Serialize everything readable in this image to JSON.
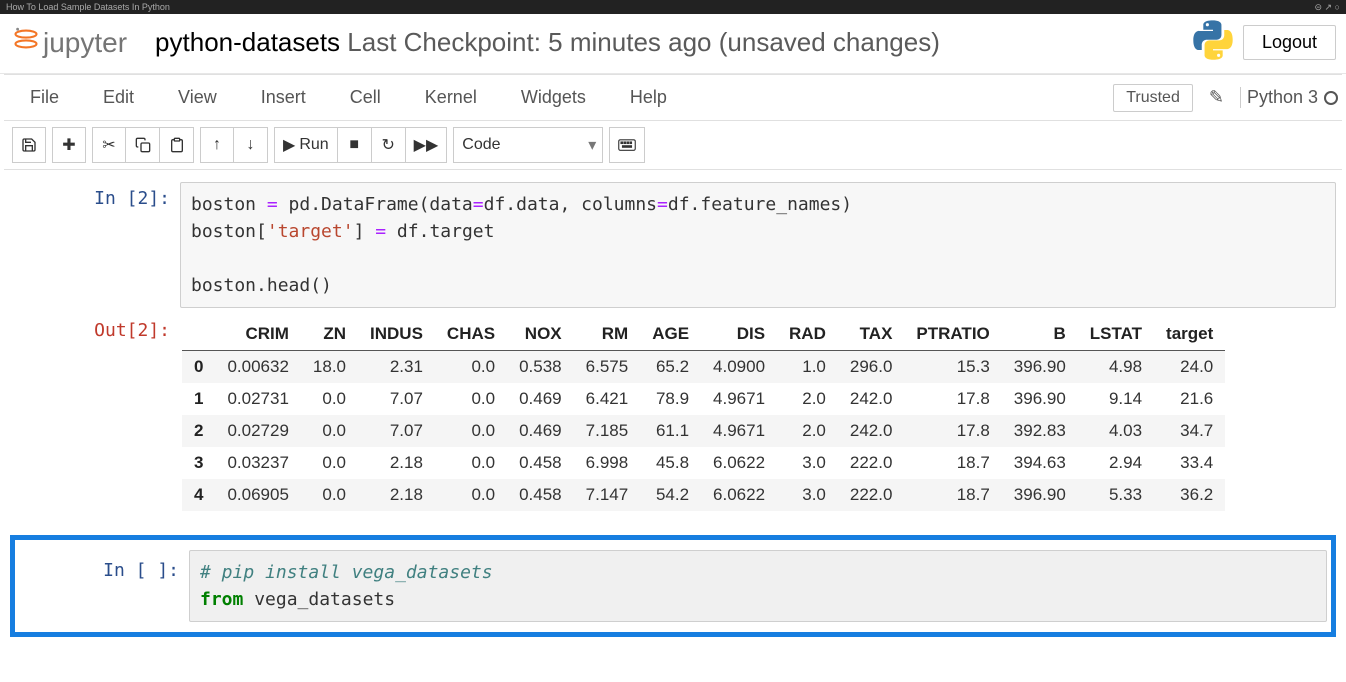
{
  "browser": {
    "tab_title": "How To Load Sample Datasets In Python"
  },
  "header": {
    "logo_text": "jupyter",
    "notebook_name": "python-datasets",
    "checkpoint_text": " Last Checkpoint: 5 minutes ago  ",
    "unsaved": "(unsaved changes)",
    "logout": "Logout"
  },
  "menubar": {
    "items": [
      "File",
      "Edit",
      "View",
      "Insert",
      "Cell",
      "Kernel",
      "Widgets",
      "Help"
    ],
    "trusted": "Trusted",
    "kernel": "Python 3"
  },
  "toolbar": {
    "run_label": "Run",
    "cell_type": "Code"
  },
  "cells": [
    {
      "prompt_in": "In [2]:",
      "code_plain": "boston = pd.DataFrame(data=df.data, columns=df.feature_names)\nboston['target'] = df.target\n\nboston.head()",
      "prompt_out": "Out[2]:",
      "table": {
        "columns": [
          "CRIM",
          "ZN",
          "INDUS",
          "CHAS",
          "NOX",
          "RM",
          "AGE",
          "DIS",
          "RAD",
          "TAX",
          "PTRATIO",
          "B",
          "LSTAT",
          "target"
        ],
        "index": [
          "0",
          "1",
          "2",
          "3",
          "4"
        ],
        "rows": [
          [
            "0.00632",
            "18.0",
            "2.31",
            "0.0",
            "0.538",
            "6.575",
            "65.2",
            "4.0900",
            "1.0",
            "296.0",
            "15.3",
            "396.90",
            "4.98",
            "24.0"
          ],
          [
            "0.02731",
            "0.0",
            "7.07",
            "0.0",
            "0.469",
            "6.421",
            "78.9",
            "4.9671",
            "2.0",
            "242.0",
            "17.8",
            "396.90",
            "9.14",
            "21.6"
          ],
          [
            "0.02729",
            "0.0",
            "7.07",
            "0.0",
            "0.469",
            "7.185",
            "61.1",
            "4.9671",
            "2.0",
            "242.0",
            "17.8",
            "392.83",
            "4.03",
            "34.7"
          ],
          [
            "0.03237",
            "0.0",
            "2.18",
            "0.0",
            "0.458",
            "6.998",
            "45.8",
            "6.0622",
            "3.0",
            "222.0",
            "18.7",
            "394.63",
            "2.94",
            "33.4"
          ],
          [
            "0.06905",
            "0.0",
            "2.18",
            "0.0",
            "0.458",
            "7.147",
            "54.2",
            "6.0622",
            "3.0",
            "222.0",
            "18.7",
            "396.90",
            "5.33",
            "36.2"
          ]
        ]
      }
    },
    {
      "prompt_in": "In [ ]:",
      "code_comment": "# pip install vega_datasets",
      "code_kw": "from",
      "code_rest": " vega_datasets"
    }
  ]
}
